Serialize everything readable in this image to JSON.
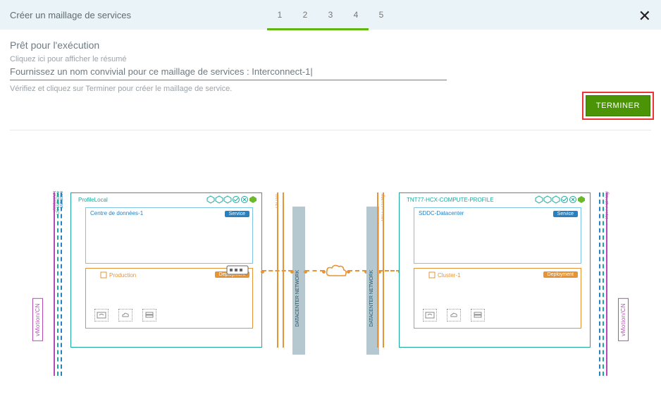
{
  "header": {
    "title": "Créer un maillage de services",
    "steps": [
      "1",
      "2",
      "3",
      "4",
      "5"
    ],
    "current_step": 5
  },
  "content": {
    "subtitle": "Prêt pour l'exécution",
    "summary_link": "Cliquez ici pour afficher le résumé",
    "name_label": "Fournissez un nom convivial pour ce maillage de services :",
    "name_value": "Interconnect-1",
    "hint": "Vérifiez et cliquez sur Terminer pour créer le maillage de service.",
    "finish_label": "TERMINER"
  },
  "diagram": {
    "left": {
      "side_label": "vMotion/CN",
      "rails": [
        "vMotion/CN",
        "CN Datastore",
        "Datastore"
      ],
      "profile": "ProfileLocal",
      "dc": "Centre de données-1",
      "dc_badge": "Service",
      "cluster": "Production",
      "cluster_badge": "Deployment",
      "network_rail_a": "CN TNT",
      "network_rail_b": "",
      "net_col": "DATACENTER NETWORK",
      "switch": "switch"
    },
    "right": {
      "side_label": "vMotion/CN",
      "rails": [
        "TNT7-7-CP-Mgr",
        "",
        ""
      ],
      "rails_label_prefix": "TNT7",
      "profile": "TNT77-HCX-COMPUTE-PROFILE",
      "dc": "SDDC-Datacenter",
      "dc_badge": "Service",
      "cluster": "Cluster-1",
      "cluster_badge": "Deployment",
      "network_rail_a": "TNT7-7-CP-Mgr",
      "net_col": "DATACENTER NETWORK",
      "switch": "switch"
    },
    "cloud": "cloud"
  }
}
